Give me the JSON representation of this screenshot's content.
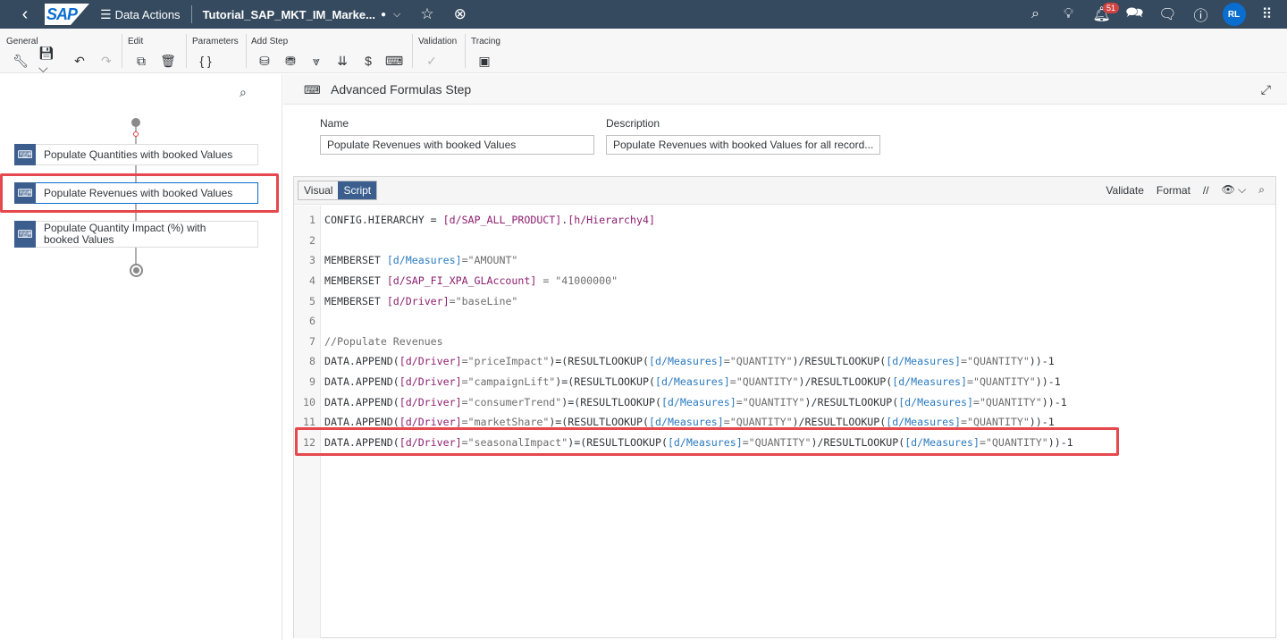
{
  "shell": {
    "app_name": "Data Actions",
    "story_title": "Tutorial_SAP_MKT_IM_Marke...",
    "notifications_count": "51",
    "avatar_initials": "RL"
  },
  "toolbar": {
    "groups": [
      "General",
      "Edit",
      "Parameters",
      "Add Step",
      "Validation",
      "Tracing"
    ]
  },
  "flow": {
    "steps": [
      {
        "label": "Populate Quantities with booked Values"
      },
      {
        "label": "Populate Revenues with booked Values"
      },
      {
        "label": "Populate Quantity Impact (%) with booked Values"
      }
    ]
  },
  "step_panel": {
    "title": "Advanced Formulas Step",
    "name_label": "Name",
    "name_value": "Populate Revenues with booked Values",
    "description_label": "Description",
    "description_value": "Populate Revenues with booked Values for all record...",
    "tab_visual": "Visual",
    "tab_script": "Script",
    "validate_label": "Validate",
    "format_label": "Format",
    "comment_label": "//"
  },
  "script": {
    "line_numbers": [
      "1",
      "2",
      "3",
      "4",
      "5",
      "6",
      "7",
      "8",
      "9",
      "10",
      "11",
      "12"
    ],
    "l1": {
      "a": "CONFIG.HIERARCHY = ",
      "b": "[d/SAP_ALL_PRODUCT]",
      "c": ".",
      "d": "[h/Hierarchy4]"
    },
    "l3": {
      "a": "MEMBERSET ",
      "b": "[d/Measures]",
      "c": "=\"AMOUNT\""
    },
    "l4": {
      "a": "MEMBERSET ",
      "b": "[d/SAP_FI_XPA_GLAccount]",
      "c": " = \"41000000\""
    },
    "l5": {
      "a": "MEMBERSET ",
      "b": "[d/Driver]",
      "c": "=\"baseLine\""
    },
    "l7": "//Populate Revenues",
    "append_prefix": "DATA.APPEND(",
    "driver_dim": "[d/Driver]",
    "lookup_open": ")=(RESULTLOOKUP(",
    "measures_dim": "[d/Measures]",
    "qty": "=\"QUANTITY\"",
    "mid": ")/RESULTLOOKUP(",
    "tail": "))-1",
    "drivers": [
      "=\"priceImpact\"",
      "=\"campaignLift\"",
      "=\"consumerTrend\"",
      "=\"marketShare\"",
      "=\"seasonalImpact\""
    ]
  }
}
